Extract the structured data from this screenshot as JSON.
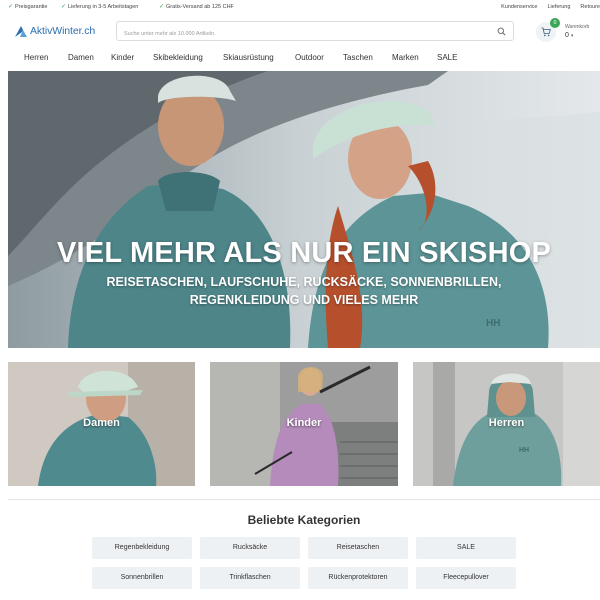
{
  "topbar": {
    "usps": [
      "Preisgarantie",
      "Lieferung in 3-5 Arbeitstagen",
      "Gratis-Versand ab 125 CHF"
    ],
    "links": [
      "Kundenservice",
      "Lieferung",
      "Retoure"
    ]
  },
  "header": {
    "logo_text": "AktivWinter.ch",
    "search_placeholder": "Suche unter mehr als 10.000 Artikeln.",
    "cart_label": "Warenkorb",
    "cart_value": "0",
    "cart_count": "0"
  },
  "nav": {
    "items": [
      "Herren",
      "Damen",
      "Kinder",
      "Skibekleidung",
      "Skiausrüstung",
      "Outdoor",
      "Taschen",
      "Marken",
      "SALE"
    ]
  },
  "hero": {
    "title": "VIEL MEHR ALS NUR EIN SKISHOP",
    "subtitle_line1": "REISETASCHEN, LAUFSCHUHE, RUCKSÄCKE, SONNENBRILLEN,",
    "subtitle_line2": "REGENKLEIDUNG UND VIELES MEHR"
  },
  "tiles": [
    "Damen",
    "Kinder",
    "Herren"
  ],
  "categories": {
    "title": "Beliebte Kategorien",
    "items": [
      "Regenbekleidung",
      "Rucksäcke",
      "Reisetaschen",
      "SALE",
      "Sonnenbrillen",
      "Trinkflaschen",
      "Rückenprotektoren",
      "Fleecepullover"
    ]
  },
  "colors": {
    "accent_green": "#3aa655",
    "brand_blue": "#2b6fae",
    "chip_bg": "#eef1f4"
  }
}
